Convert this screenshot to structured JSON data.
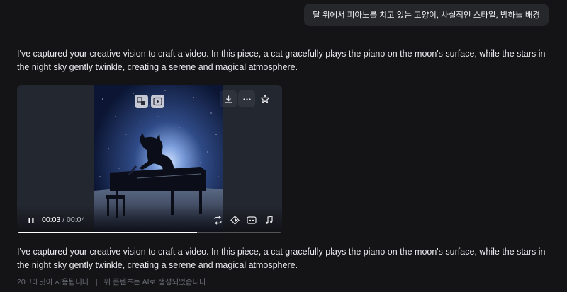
{
  "user_prompt": "달 위에서 피아노를 치고 있는 고양이, 사실적인 스타일, 밤하늘 배경",
  "assistant_message_top": "I've captured your creative vision to craft a video. In this piece, a cat gracefully plays the piano on the moon's surface, while the stars in the night sky gently twinkle, creating a serene and magical atmosphere.",
  "assistant_message_bottom": "I've captured your creative vision to craft a video. In this piece, a cat gracefully plays the piano on the moon's surface, while the stars in the night sky gently twinkle, creating a serene and magical atmosphere.",
  "video": {
    "current_time": "00:03",
    "separator": " / ",
    "duration": "00:04",
    "progress_percent": 68,
    "overlay_icons": [
      "image-swap-icon",
      "play-frame-icon"
    ],
    "top_actions": [
      "download-icon",
      "more-icon",
      "star-icon"
    ],
    "control_icons": [
      "loop-icon",
      "diamond-icon",
      "subtitles-icon",
      "music-icon"
    ]
  },
  "footer": {
    "credits": "20크레딧이 사용됩니다",
    "ai_notice": "위 콘텐츠는 AI로 생성되었습니다."
  },
  "colors": {
    "background": "#141416",
    "bubble": "#26272b",
    "footer_text": "#6b6e78"
  }
}
